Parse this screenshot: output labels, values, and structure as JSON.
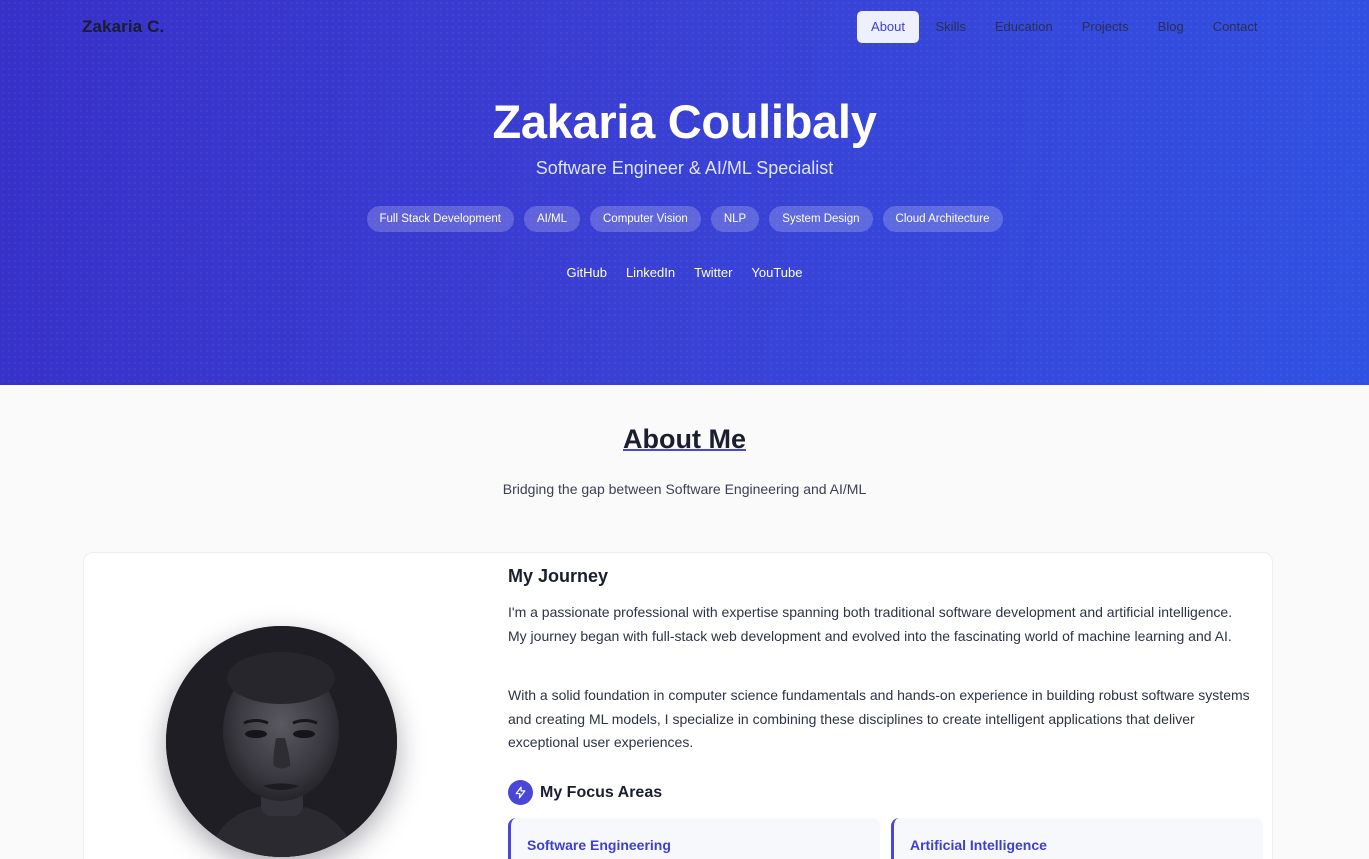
{
  "brand": "Zakaria C.",
  "nav": [
    "About",
    "Skills",
    "Education",
    "Projects",
    "Blog",
    "Contact"
  ],
  "hero": {
    "name": "Zakaria Coulibaly",
    "subtitle": "Software Engineer & AI/ML Specialist",
    "tags": [
      "Full Stack Development",
      "AI/ML",
      "Computer Vision",
      "NLP",
      "System Design",
      "Cloud Architecture"
    ],
    "socials": [
      "GitHub",
      "LinkedIn",
      "Twitter",
      "YouTube"
    ]
  },
  "about": {
    "title": "About Me",
    "subtitle": "Bridging the gap between Software Engineering and AI/ML",
    "journey_title": "My Journey",
    "paragraph1": "I'm a passionate professional with expertise spanning both traditional software development and artificial intelligence. My journey began with full-stack web development and evolved into the fascinating world of machine learning and AI.",
    "paragraph2": "With a solid foundation in computer science fundamentals and hands-on experience in building robust software systems and creating ML models, I specialize in combining these disciplines to create intelligent applications that deliver exceptional user experiences.",
    "focus_title": "My Focus Areas",
    "focus_areas": [
      "Software Engineering",
      "Artificial Intelligence"
    ]
  },
  "colors": {
    "accent": "#4a46d8",
    "hero_start": "#3730c9",
    "hero_end": "#3052e3"
  },
  "icons": {
    "focus": "lightning-icon",
    "avatar": "profile-photo"
  }
}
